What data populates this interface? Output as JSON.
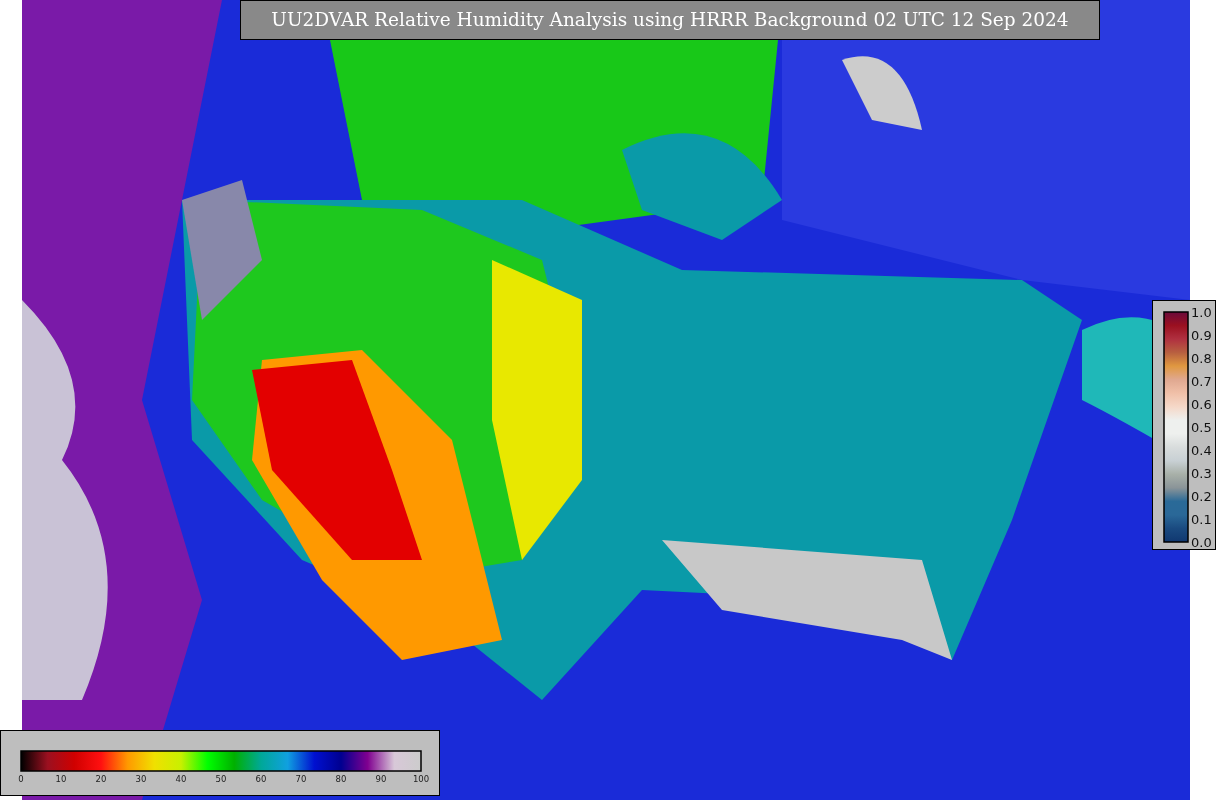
{
  "title": "UU2DVAR Relative Humidity Analysis using HRRR Background 02 UTC 12 Sep 2024",
  "bottom_colorbar": {
    "ticks": [
      "0",
      "10",
      "20",
      "30",
      "40",
      "50",
      "60",
      "70",
      "80",
      "90",
      "100"
    ]
  },
  "right_colorbar": {
    "ticks": [
      "1.0",
      "0.9",
      "0.8",
      "0.7",
      "0.6",
      "0.5",
      "0.4",
      "0.3",
      "0.2",
      "0.1",
      "0.0"
    ]
  }
}
